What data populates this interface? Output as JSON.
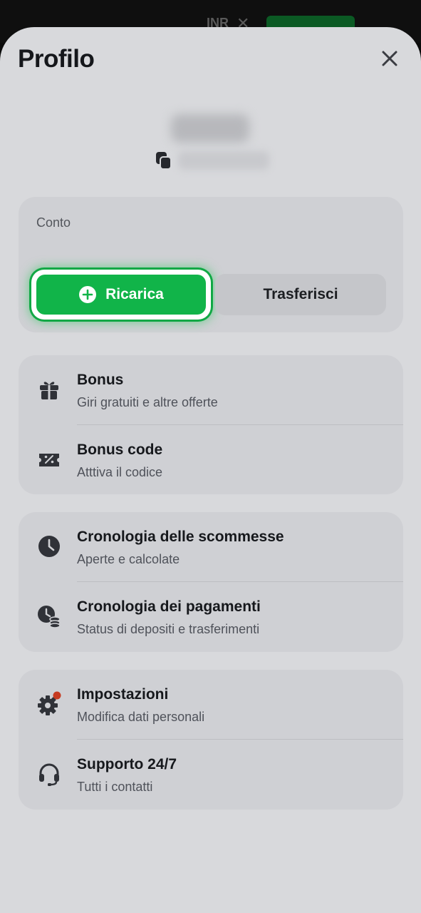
{
  "background": {
    "logo": "",
    "currency": "INR",
    "currency_close": "✕"
  },
  "profile": {
    "title": "Profilo",
    "user_name": "",
    "user_id": ""
  },
  "account": {
    "label": "Conto",
    "deposit_label": "Ricarica",
    "transfer_label": "Trasferisci"
  },
  "menu": {
    "bonus": {
      "title": "Bonus",
      "subtitle": "Giri gratuiti e altre offerte"
    },
    "bonus_code": {
      "title": "Bonus code",
      "subtitle": "Atttiva il codice"
    },
    "bet_history": {
      "title": "Cronologia delle scommesse",
      "subtitle": "Aperte e calcolate"
    },
    "payment_history": {
      "title": "Cronologia dei pagamenti",
      "subtitle": "Status di depositi e trasferimenti"
    },
    "settings": {
      "title": "Impostazioni",
      "subtitle": "Modifica dati personali"
    },
    "support": {
      "title": "Supporto 24/7",
      "subtitle": "Tutti i contatti"
    }
  },
  "colors": {
    "accent_green": "#11b449",
    "notification_dot": "#c63a21",
    "sheet_bg": "#d8d9dc",
    "card_bg": "#cfd0d4"
  },
  "icons": {
    "close": "close-icon",
    "copy": "copy-icon",
    "plus": "plus-circle-icon",
    "gift": "gift-icon",
    "ticket": "ticket-icon",
    "clock": "clock-icon",
    "payments": "clock-coins-icon",
    "gear": "gear-icon",
    "headset": "headset-icon"
  }
}
